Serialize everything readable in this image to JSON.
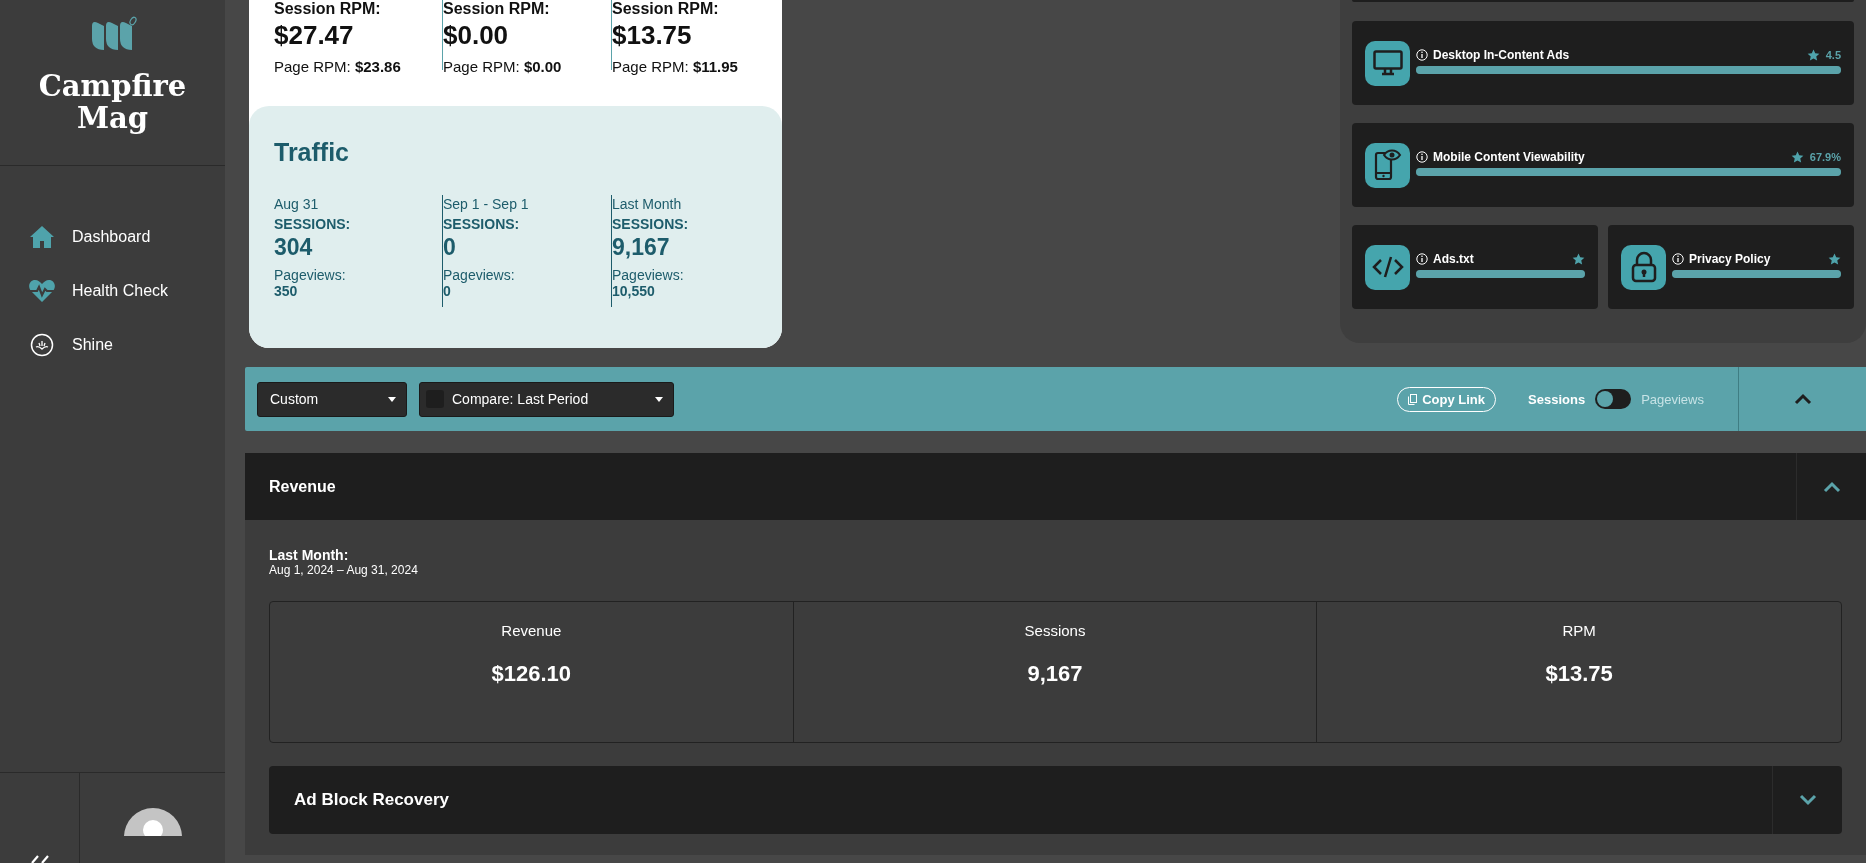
{
  "sidebar": {
    "brand": "Campfire Mag",
    "nav": [
      {
        "label": "Dashboard",
        "selected": false
      },
      {
        "label": "Health Check",
        "selected": false
      },
      {
        "label": "Shine",
        "selected": false
      }
    ]
  },
  "rpm": [
    {
      "label": "Session RPM:",
      "value": "$27.47",
      "page_label": "Page RPM:",
      "page_value": "$23.86"
    },
    {
      "label": "Session RPM:",
      "value": "$0.00",
      "page_label": "Page RPM:",
      "page_value": "$0.00"
    },
    {
      "label": "Session RPM:",
      "value": "$13.75",
      "page_label": "Page RPM:",
      "page_value": "$11.95"
    }
  ],
  "traffic": {
    "title": "Traffic",
    "columns": [
      {
        "period": "Aug 31",
        "sessions_label": "SESSIONS:",
        "sessions": "304",
        "pageviews_label": "Pageviews:",
        "pageviews": "350"
      },
      {
        "period": "Sep 1 - Sep 1",
        "sessions_label": "SESSIONS:",
        "sessions": "0",
        "pageviews_label": "Pageviews:",
        "pageviews": "0"
      },
      {
        "period": "Last Month",
        "sessions_label": "SESSIONS:",
        "sessions": "9,167",
        "pageviews_label": "Pageviews:",
        "pageviews": "10,550"
      }
    ]
  },
  "health": [
    {
      "title": "Desktop In-Content Ads",
      "score": "4.5",
      "level": 1
    },
    {
      "title": "Mobile Content Viewability",
      "score": "67.9%",
      "level": 1
    },
    {
      "title": "Ads.txt",
      "level": 1
    },
    {
      "title": "Privacy Policy",
      "level": 1
    }
  ],
  "toolbar": {
    "range": "Custom",
    "compare": {
      "label": "Compare: Last Period",
      "checked": false
    },
    "copy_link": "Copy Link",
    "toggle": [
      {
        "label": "Sessions",
        "selected": true
      },
      {
        "label": "Pageviews",
        "selected": false
      }
    ],
    "expanded": true
  },
  "revenue": {
    "title": "Revenue",
    "expanded": true,
    "period_label": "Last Month:",
    "period_range": "Aug 1, 2024 – Aug 31, 2024",
    "stats": [
      {
        "label": "Revenue",
        "value": "$126.10"
      },
      {
        "label": "Sessions",
        "value": "9,167"
      },
      {
        "label": "RPM",
        "value": "$13.75"
      }
    ]
  },
  "ad_block": {
    "title": "Ad Block Recovery",
    "expanded": false
  }
}
